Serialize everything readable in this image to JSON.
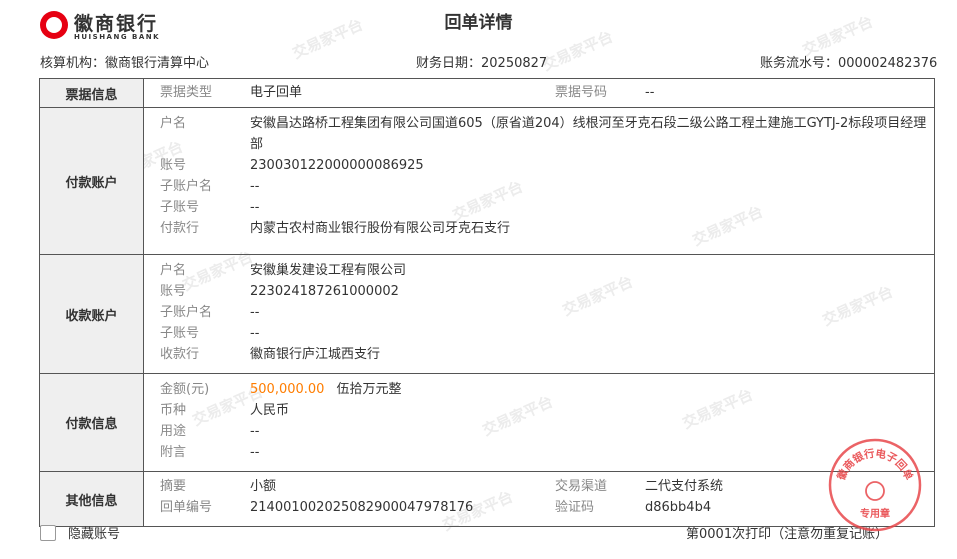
{
  "header": {
    "bank_name_cn": "徽商银行",
    "bank_name_en": "HUISHANG BANK",
    "title": "回单详情"
  },
  "meta": {
    "org_label": "核算机构：",
    "org_value": "徽商银行清算中心",
    "date_label": "财务日期：",
    "date_value": "20250827",
    "serial_label": "账务流水号：",
    "serial_value": "000002482376"
  },
  "ticket": {
    "section": "票据信息",
    "type_label": "票据类型",
    "type_value": "电子回单",
    "no_label": "票据号码",
    "no_value": "--"
  },
  "payer": {
    "section": "付款账户",
    "name_label": "户名",
    "name_value": "安徽昌达路桥工程集团有限公司国道605（原省道204）线根河至牙克石段二级公路工程土建施工GYTJ-2标段项目经理部",
    "acct_label": "账号",
    "acct_value": "230030122000000086925",
    "sub_name_label": "子账户名",
    "sub_name_value": "--",
    "sub_acct_label": "子账号",
    "sub_acct_value": "--",
    "bank_label": "付款行",
    "bank_value": "内蒙古农村商业银行股份有限公司牙克石支行"
  },
  "payee": {
    "section": "收款账户",
    "name_label": "户名",
    "name_value": "安徽巢发建设工程有限公司",
    "acct_label": "账号",
    "acct_value": "223024187261000002",
    "sub_name_label": "子账户名",
    "sub_name_value": "--",
    "sub_acct_label": "子账号",
    "sub_acct_value": "--",
    "bank_label": "收款行",
    "bank_value": "徽商银行庐江城西支行"
  },
  "payment": {
    "section": "付款信息",
    "amount_label": "金额(元)",
    "amount_value": "500,000.00",
    "amount_cn": "伍拾万元整",
    "currency_label": "币种",
    "currency_value": "人民币",
    "purpose_label": "用途",
    "purpose_value": "--",
    "note_label": "附言",
    "note_value": "--"
  },
  "other": {
    "section": "其他信息",
    "summary_label": "摘要",
    "summary_value": "小额",
    "receipt_no_label": "回单编号",
    "receipt_no_value": "21400100202508290004797817 6",
    "channel_label": "交易渠道",
    "channel_value": "二代支付系统",
    "verify_label": "验证码",
    "verify_value": "d86bb4b4"
  },
  "footer": {
    "hide_account_label": "隐藏账号",
    "print_note": "第0001次打印（注意勿重复记账）"
  },
  "seal": {
    "text_top": "徽商银行电子回单",
    "text_bottom": "专用章"
  },
  "watermark": {
    "text": "交易家平台"
  },
  "colors": {
    "amount": "#ff7d00",
    "seal": "#e8484b",
    "brand": "#e60012"
  }
}
